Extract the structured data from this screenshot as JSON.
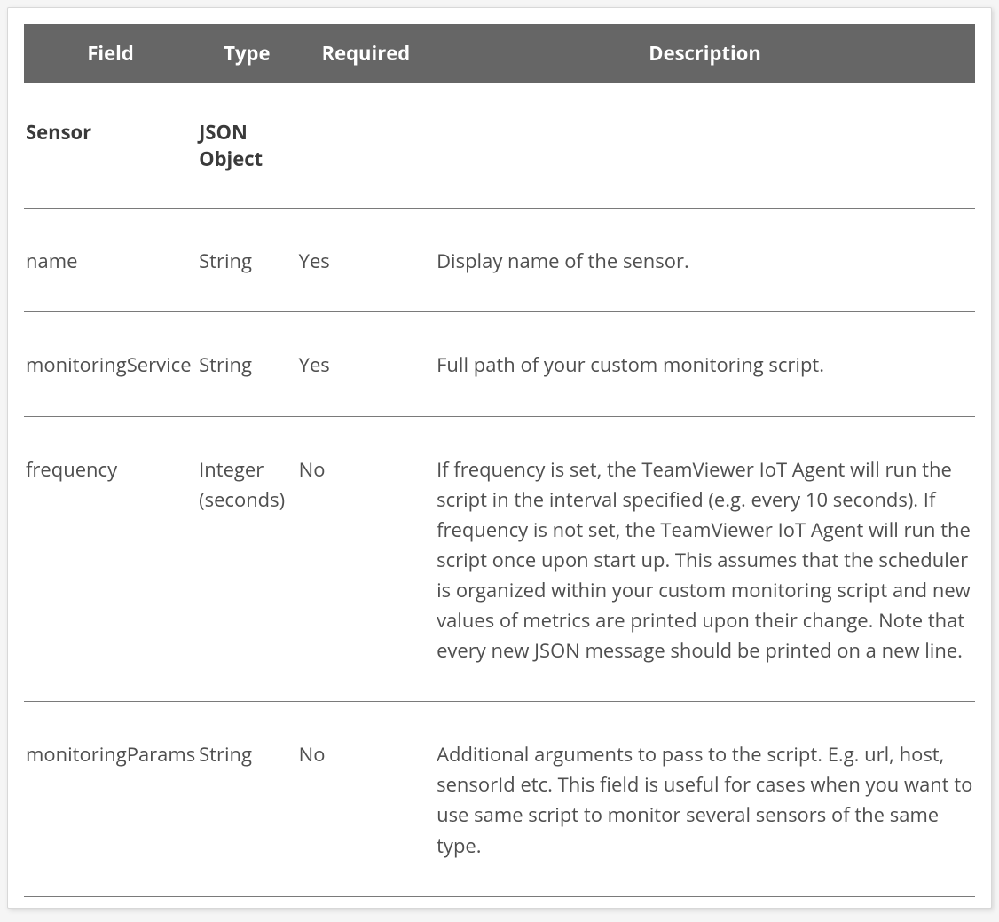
{
  "headers": {
    "field": "Field",
    "type": "Type",
    "required": "Required",
    "description": "Description"
  },
  "rows": [
    {
      "section": true,
      "field": "Sensor",
      "type": "JSON Object",
      "required": "",
      "description": ""
    },
    {
      "section": false,
      "field": "name",
      "type": "String",
      "required": "Yes",
      "description": "Display name of the sensor."
    },
    {
      "section": false,
      "field": "monitoringService",
      "type": "String",
      "required": "Yes",
      "description": "Full path of your custom monitoring script."
    },
    {
      "section": false,
      "field": "frequency",
      "type": "Integer (seconds)",
      "required": "No",
      "description": "If frequency is set, the TeamViewer IoT Agent will run the script in the interval specified (e.g. every 10 seconds). If frequency is not set, the TeamViewer IoT Agent will run the script once upon start up.  This assumes that the scheduler is organized within your custom monitoring script and new values of metrics are printed upon their change. Note that every new JSON message should be printed on a new line."
    },
    {
      "section": false,
      "field": "monitoringParams",
      "type": "String",
      "required": "No",
      "description": "Additional arguments to pass to the script. E.g. url, host, sensorId etc. This field is useful for cases when you want to use same script to monitor several sensors of the same type."
    }
  ]
}
